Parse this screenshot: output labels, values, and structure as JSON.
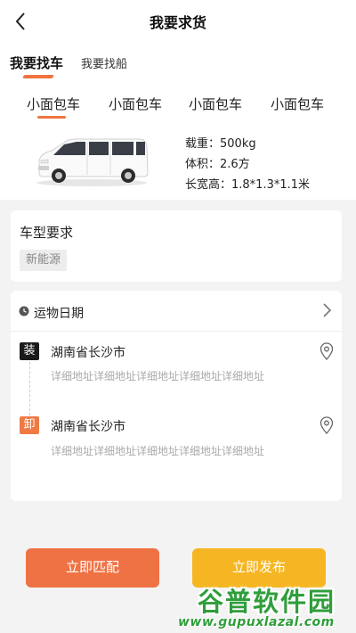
{
  "header": {
    "title": "我要求货",
    "back_icon": "chevron-left-icon"
  },
  "mode_tabs": [
    {
      "label": "我要找车",
      "active": true
    },
    {
      "label": "我要找船",
      "active": false
    }
  ],
  "vehicle_tabs": [
    "小面包车",
    "小面包车",
    "小面包车",
    "小面包车"
  ],
  "vehicle_specs": [
    "载重：500kg",
    "体积：2.6方",
    "长宽高：1.8*1.3*1.1米"
  ],
  "requirements": {
    "title": "车型要求",
    "chip": "新能源"
  },
  "route": {
    "date_label": "运物日期",
    "load": {
      "badge": "装",
      "city": "湖南省长沙市",
      "detail": "详细地址详细地址详细地址详细地址详细地址"
    },
    "unload": {
      "badge": "卸",
      "city": "湖南省长沙市",
      "detail": "详细地址详细地址详细地址详细地址详细地址"
    }
  },
  "actions": {
    "match": "立即匹配",
    "publish": "立即发布"
  },
  "watermark": {
    "name": "谷普软件园",
    "url": "www.gupuxlazal.com"
  },
  "colors": {
    "accent": "#ef7244",
    "publish": "#f6b623",
    "load_badge": "#1b1b1b",
    "unload_badge": "#ef7a44"
  }
}
